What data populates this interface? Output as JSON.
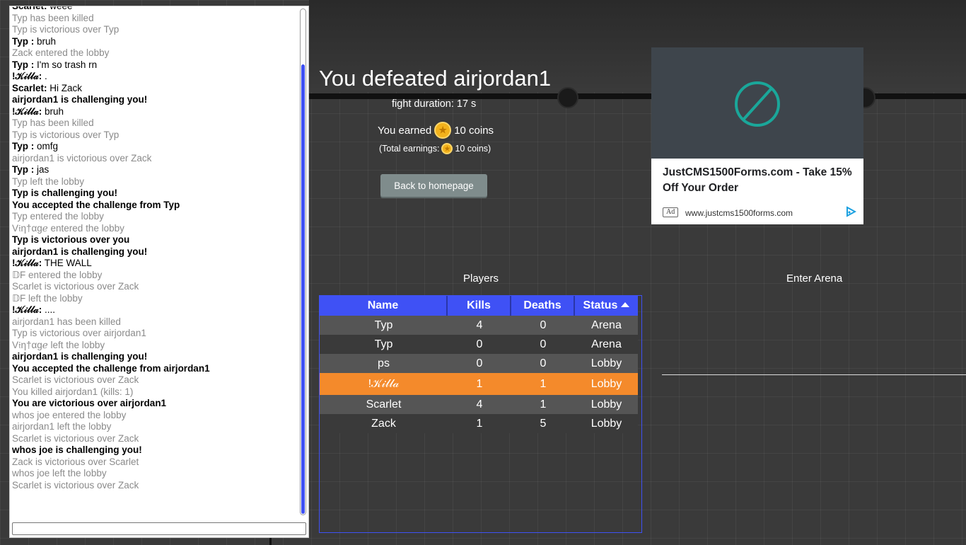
{
  "chat": {
    "messages": [
      {
        "type": "say",
        "author": "Scarlet:",
        "text": "weee"
      },
      {
        "type": "event",
        "text": "Typ has been killed"
      },
      {
        "type": "event",
        "text": "Typ is victorious over Typ"
      },
      {
        "type": "say",
        "author": "Typ :",
        "text": "bruh"
      },
      {
        "type": "event",
        "text": "Zack entered the lobby"
      },
      {
        "type": "say",
        "author": "Typ :",
        "text": "I'm so trash rn"
      },
      {
        "type": "say",
        "author": "!𝒦𝒾𝓁𝓁𝒶:",
        "text": "."
      },
      {
        "type": "say",
        "author": "Scarlet:",
        "text": "Hi Zack"
      },
      {
        "type": "bold",
        "text": "airjordan1 is challenging you!"
      },
      {
        "type": "say",
        "author": "!𝒦𝒾𝓁𝓁𝒶:",
        "text": "bruh"
      },
      {
        "type": "event",
        "text": "Typ has been killed"
      },
      {
        "type": "event",
        "text": "Typ is victorious over Typ"
      },
      {
        "type": "say",
        "author": "Typ :",
        "text": "omfg"
      },
      {
        "type": "event",
        "text": "airjordan1 is victorious over Zack"
      },
      {
        "type": "say",
        "author": "Typ :",
        "text": "jas"
      },
      {
        "type": "event",
        "text": "Typ left the lobby"
      },
      {
        "type": "bold",
        "text": "Typ is challenging you!"
      },
      {
        "type": "bold",
        "text": "You accepted the challenge from Typ"
      },
      {
        "type": "event",
        "text": "Typ entered the lobby"
      },
      {
        "type": "event",
        "text": "V𝔦η†αgℯ entered the lobby"
      },
      {
        "type": "bold",
        "text": "Typ is victorious over you"
      },
      {
        "type": "bold",
        "text": "airjordan1 is challenging you!"
      },
      {
        "type": "say",
        "author": "!𝒦𝒾𝓁𝓁𝒶:",
        "text": "THE WALL"
      },
      {
        "type": "event",
        "text": "𝔻F entered the lobby"
      },
      {
        "type": "event",
        "text": "Scarlet is victorious over Zack"
      },
      {
        "type": "event",
        "text": "𝔻F left the lobby"
      },
      {
        "type": "say",
        "author": "!𝒦𝒾𝓁𝓁𝒶:",
        "text": "...."
      },
      {
        "type": "event",
        "text": "airjordan1 has been killed"
      },
      {
        "type": "event",
        "text": "Typ is victorious over airjordan1"
      },
      {
        "type": "event",
        "text": "V𝔦η†αgℯ left the lobby"
      },
      {
        "type": "bold",
        "text": "airjordan1 is challenging you!"
      },
      {
        "type": "bold",
        "text": "You accepted the challenge from airjordan1"
      },
      {
        "type": "event",
        "text": "Scarlet is victorious over Zack"
      },
      {
        "type": "event",
        "text": "You killed airjordan1 (kills: 1)"
      },
      {
        "type": "bold",
        "text": "You are victorious over airjordan1"
      },
      {
        "type": "event",
        "text": "whos joe entered the lobby"
      },
      {
        "type": "event",
        "text": "airjordan1 left the lobby"
      },
      {
        "type": "event",
        "text": "Scarlet is victorious over Zack"
      },
      {
        "type": "bold",
        "text": "whos joe is challenging you!"
      },
      {
        "type": "event",
        "text": "Zack is victorious over Scarlet"
      },
      {
        "type": "event",
        "text": "whos joe left the lobby"
      },
      {
        "type": "event",
        "text": "Scarlet is victorious over Zack"
      }
    ],
    "input_value": ""
  },
  "result": {
    "title": "You defeated airjordan1",
    "duration": "fight duration: 17 s",
    "earned_prefix": "You earned",
    "earned_coins": "10 coins",
    "total_prefix": "(Total earnings:",
    "total_coins": "10 coins)",
    "back_label": "Back to homepage"
  },
  "ad": {
    "headline": "JustCMS1500Forms.com - Take 15% Off Your Order",
    "badge": "Ad",
    "url": "www.justcms1500forms.com",
    "accent": "#1aa79a"
  },
  "players": {
    "heading": "Players",
    "columns": {
      "name": "Name",
      "kills": "Kills",
      "deaths": "Deaths",
      "status": "Status"
    },
    "rows": [
      {
        "name": "Typ",
        "kills": "4",
        "deaths": "0",
        "status": "Arena"
      },
      {
        "name": "Typ",
        "kills": "0",
        "deaths": "0",
        "status": "Arena"
      },
      {
        "name": "ps",
        "kills": "0",
        "deaths": "0",
        "status": "Lobby"
      },
      {
        "name": "!𝒦𝒾𝓁𝓁𝒶",
        "kills": "1",
        "deaths": "1",
        "status": "Lobby"
      },
      {
        "name": "Scarlet",
        "kills": "4",
        "deaths": "1",
        "status": "Lobby"
      },
      {
        "name": "Zack",
        "kills": "1",
        "deaths": "5",
        "status": "Lobby"
      }
    ]
  },
  "arena": {
    "heading": "Enter Arena"
  },
  "colors": {
    "accent": "#3f51f5",
    "highlight": "#f48a2b",
    "coin": "#f3b21c"
  }
}
